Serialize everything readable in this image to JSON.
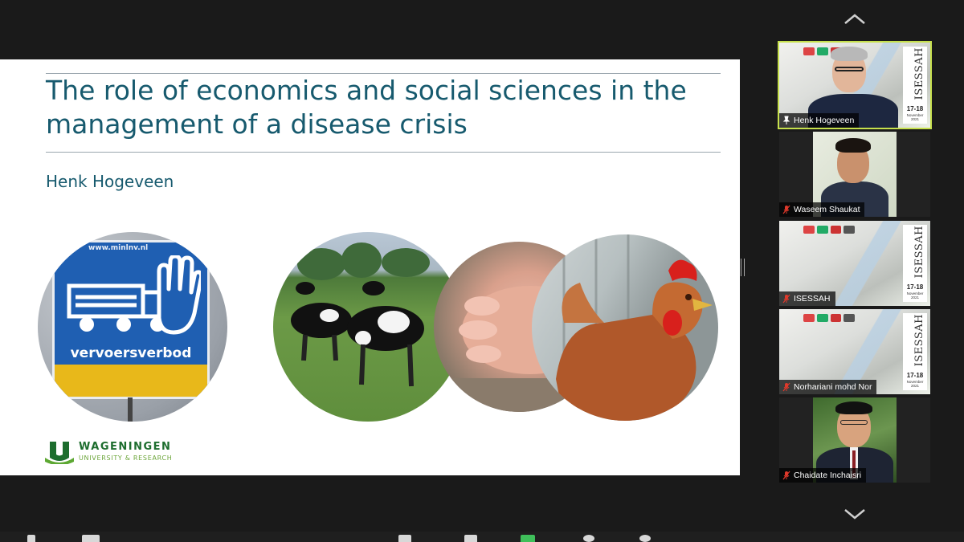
{
  "slide": {
    "title": "The role of economics and social sciences in the management of a disease crisis",
    "author": "Henk Hogeveen",
    "sign": {
      "url": "www.minlnv.nl",
      "text": "vervoersverbod"
    },
    "logo": {
      "name": "WAGENINGEN",
      "subtitle": "UNIVERSITY & RESEARCH"
    },
    "photos": [
      "cows-photo",
      "pigs-photo",
      "hen-photo"
    ]
  },
  "gallery": {
    "participants": [
      {
        "name": "Henk Hogeveen",
        "active": true,
        "video": "person",
        "icon": "pin-icon"
      },
      {
        "name": "Waseem Shaukat",
        "active": false,
        "video": "person",
        "icon": "mic-muted-icon"
      },
      {
        "name": "ISESSAH",
        "active": false,
        "video": "banner",
        "icon": "mic-muted-icon"
      },
      {
        "name": "Norhariani mohd Nor",
        "active": false,
        "video": "banner",
        "icon": "mic-muted-icon"
      },
      {
        "name": "Chaidate Inchaisri",
        "active": false,
        "video": "person",
        "icon": "mic-muted-icon"
      }
    ],
    "banner": {
      "word": "ISESSAH",
      "year": "2021",
      "dates": "17-18",
      "month": "November 2021"
    }
  },
  "colors": {
    "slide_title": "#175a6e",
    "active_border": "#c6e04c",
    "muted_icon": "#e0392b",
    "meeting_background": "#1a1a1a"
  }
}
